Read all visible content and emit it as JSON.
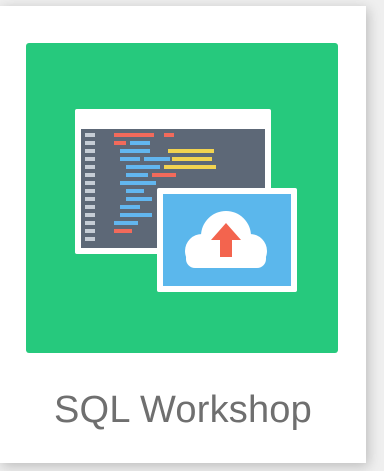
{
  "app_card": {
    "label": "SQL Workshop",
    "icon": "sql-workshop-upload-icon",
    "colors": {
      "tile_background": "#26c97d",
      "editor_frame": "#ffffff",
      "editor_background": "#5d6877",
      "upload_panel": "#5bb7ec",
      "cloud": "#ffffff",
      "arrow": "#f3644e",
      "code_red": "#f26a5b",
      "code_blue": "#62b6ef",
      "code_yellow": "#f2d350",
      "gutter": "#c6cdd6",
      "label_text": "#6f6f6f"
    }
  }
}
